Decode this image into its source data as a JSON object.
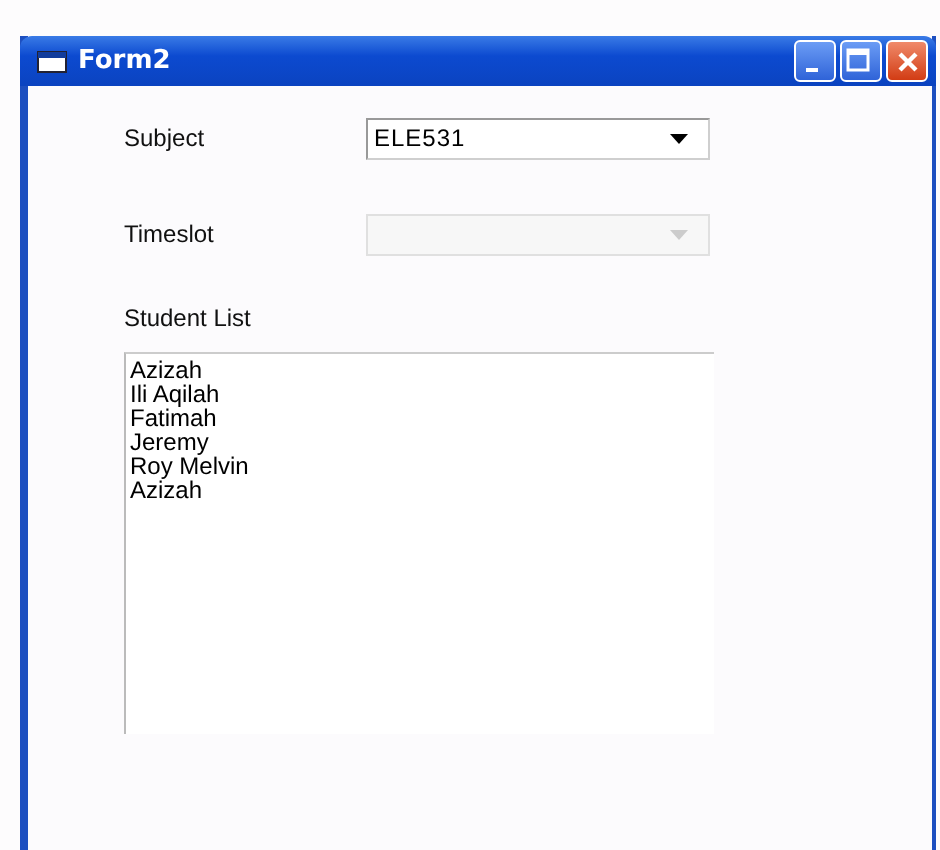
{
  "window": {
    "title": "Form2"
  },
  "fields": [
    {
      "label": "Subject",
      "value": "ELE531",
      "disabled": false
    },
    {
      "label": "Timeslot",
      "disabled": true
    }
  ],
  "student_list": {
    "label": "Student List",
    "items": [
      "Azizah",
      "Ili Aqilah",
      "Fatimah",
      "Jeremy",
      "Roy Melvin",
      "Azizah"
    ]
  }
}
